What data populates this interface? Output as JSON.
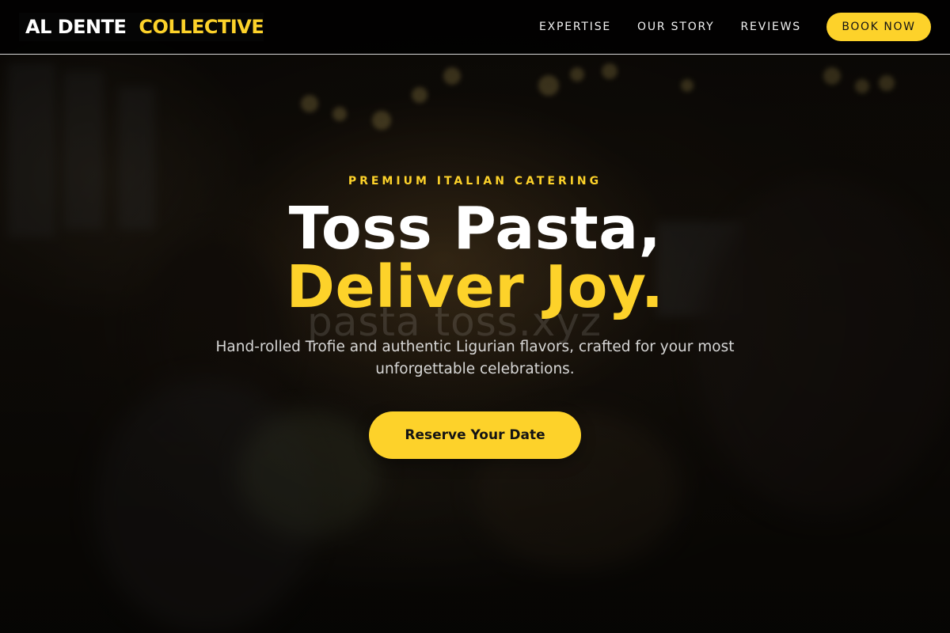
{
  "header": {
    "logo_primary": "AL DENTE",
    "logo_accent": "COLLECTIVE",
    "nav": [
      {
        "label": "EXPERTISE"
      },
      {
        "label": "OUR STORY"
      },
      {
        "label": "REVIEWS"
      }
    ],
    "book_label": "BOOK NOW"
  },
  "hero": {
    "eyebrow": "PREMIUM ITALIAN CATERING",
    "headline_line1": "Toss Pasta,",
    "headline_line2": "Deliver Joy.",
    "subtitle": "Hand-rolled Trofie and authentic Ligurian flavors, crafted for your most unforgettable celebrations.",
    "cta_label": "Reserve Your Date",
    "watermark": "pasta toss.xyz"
  },
  "colors": {
    "accent": "#fdd22a",
    "header_bg": "#000000",
    "text_light": "#ffffff"
  }
}
